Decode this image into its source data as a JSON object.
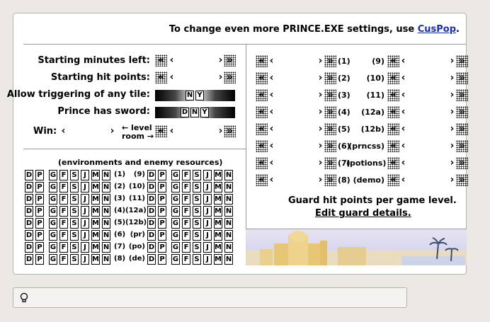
{
  "header": {
    "prefix": "To change even more PRINCE.EXE settings, use ",
    "link": "CusPop",
    "suffix": "."
  },
  "settings": {
    "starting_minutes": "Starting minutes left:",
    "starting_hp": "Starting hit points:",
    "allow_trigger": "Allow triggering of any tile:",
    "prince_sword": "Prince has sword:",
    "win": "Win:",
    "level_label": "← level",
    "room_label": "room →",
    "trigger_options": [
      "N",
      "Y"
    ],
    "sword_options": [
      "D",
      "N",
      "Y"
    ]
  },
  "environments": {
    "title": "(environments and enemy resources)",
    "env_options": [
      "D",
      "P"
    ],
    "guard_options": [
      "G",
      "F",
      "S",
      "J",
      "M",
      "N"
    ],
    "left_labels": [
      "(1)",
      "(2)",
      "(3)",
      "(4)",
      "(5)",
      "(6)",
      "(7)",
      "(8)"
    ],
    "mid_labels": [
      "(9)",
      "(10)",
      "(11)",
      "(12a)",
      "(12b)",
      "(pr)",
      "(po)",
      "(de)"
    ]
  },
  "guard_hp": {
    "left_labels": [
      "(1)",
      "(2)",
      "(3)",
      "(4)",
      "(5)",
      "(6)",
      "(7)",
      "(8)"
    ],
    "right_labels": [
      "(9)",
      "(10)",
      "(11)",
      "(12a)",
      "(12b)",
      "(prncss)",
      "(potions)",
      "(demo)"
    ],
    "footer": "Guard hit points per game level.",
    "edit_link": "Edit guard details."
  },
  "icons": {
    "fast_left": "«‹",
    "left": "‹",
    "right": "›",
    "fast_right": "›»",
    "status": "lightbulb-icon"
  }
}
